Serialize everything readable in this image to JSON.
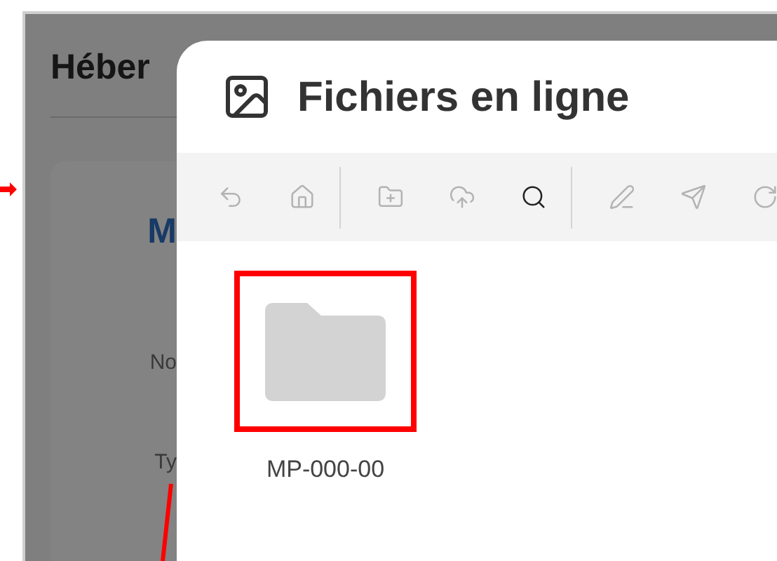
{
  "background": {
    "heading": "Héber",
    "card_title": "M",
    "labels": [
      "No",
      "Ty"
    ]
  },
  "dialog": {
    "title": "Fichiers en ligne",
    "toolbar": [
      [
        {
          "disabled": true
        },
        {
          "disabled": true
        }
      ],
      [
        {
          "disabled": true
        },
        {
          "disabled": true
        },
        {
          "disabled": false
        }
      ],
      [
        {
          "disabled": true
        },
        {
          "disabled": true
        },
        {
          "disabled": true
        }
      ]
    ],
    "items": [
      {
        "name": "MP-000-00",
        "highlighted": true
      }
    ]
  }
}
